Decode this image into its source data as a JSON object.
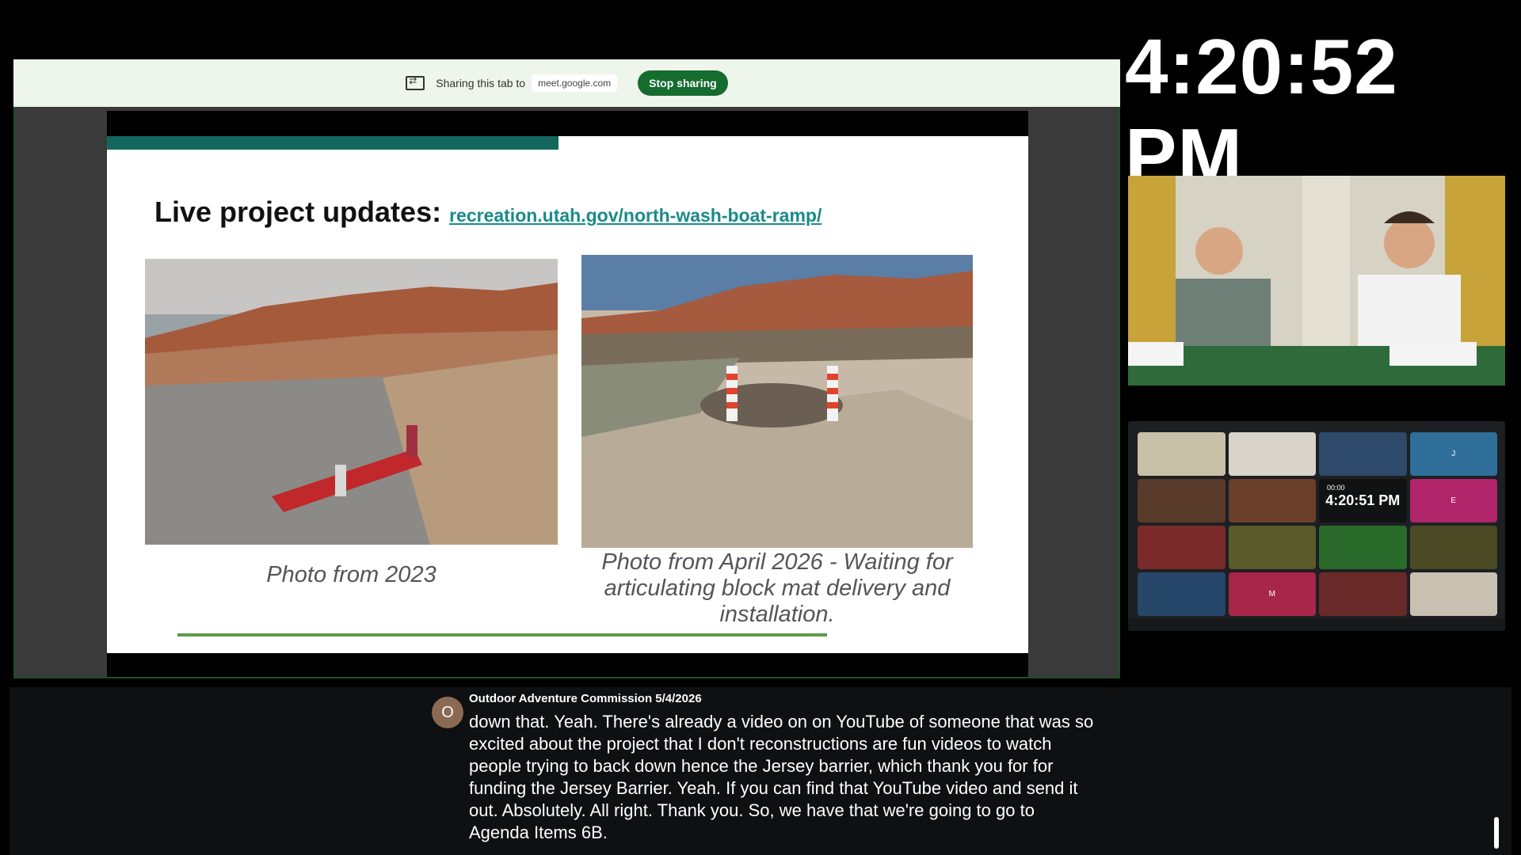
{
  "clock": {
    "time": "4:20:52 PM"
  },
  "share_bar": {
    "text": "Sharing this tab to",
    "domain": "meet.google.com",
    "stop_label": "Stop sharing"
  },
  "slide": {
    "title": "Live project updates:",
    "link": "recreation.utah.gov/north-wash-boat-ramp/",
    "photo1_caption": "Photo from 2023",
    "photo2_caption": "Photo from April 2026 - Waiting for articulating block mat delivery and installation."
  },
  "video_grid": {
    "mini_time": "4:20:51 PM",
    "mini_timer": "00:00",
    "tiles": [
      "",
      "",
      "",
      "J",
      "",
      "",
      "",
      "E",
      "",
      "",
      "",
      "",
      "",
      "M",
      "",
      ""
    ]
  },
  "captions": {
    "avatar": "O",
    "speaker": "Outdoor Adventure Commission 5/4/2026",
    "text": "down that. Yeah. There's already a video on on YouTube of someone that was so excited about the project that I don't reconstructions are fun videos to watch people trying to back down hence the Jersey barrier, which thank you for for funding the Jersey Barrier. Yeah. If you can find that YouTube video and send it out. Absolutely. All right. Thank you. So, we have that we're going to go to Agenda Items 6B."
  }
}
